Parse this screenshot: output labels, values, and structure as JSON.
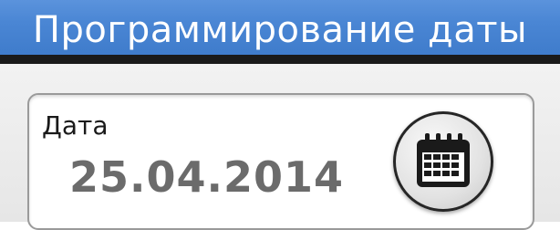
{
  "window": {
    "title": "Программирование даты"
  },
  "date_field": {
    "label": "Дата",
    "value": "25.04.2014"
  },
  "icons": {
    "calendar": "calendar-icon"
  },
  "colors": {
    "title_bar": "#4a86d4",
    "date_value": "#6b6b6b"
  }
}
